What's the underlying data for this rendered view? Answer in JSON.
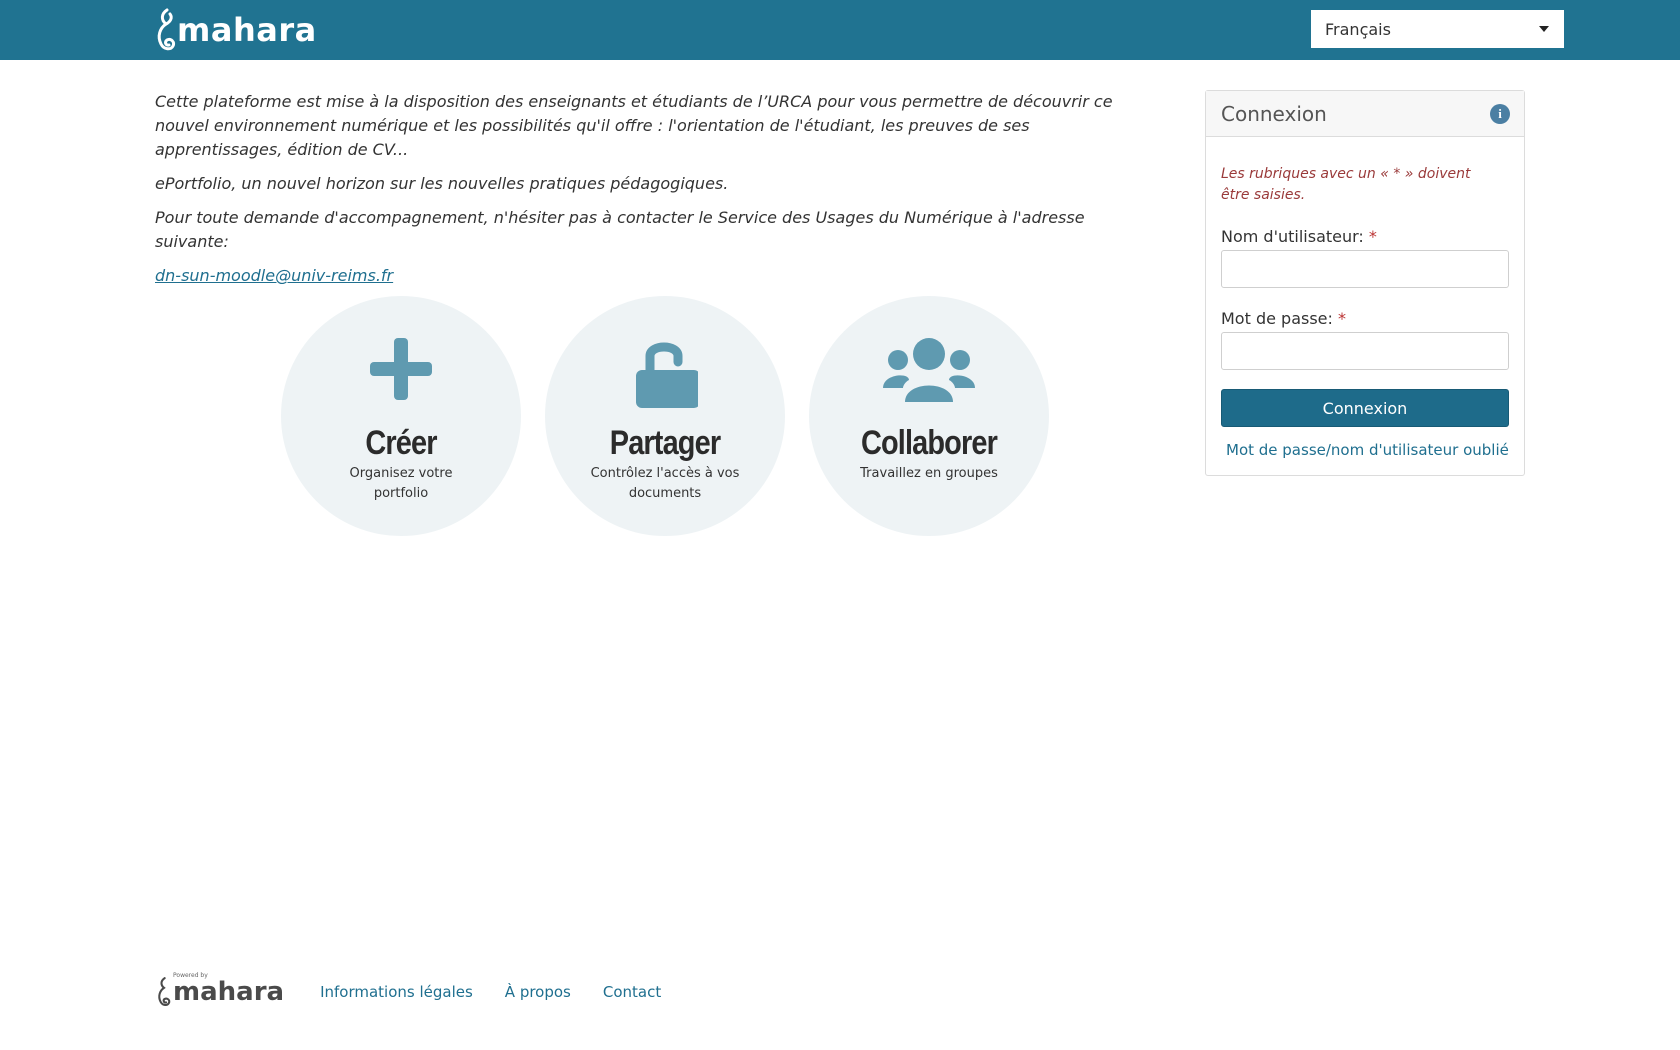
{
  "header": {
    "logo_text": "mahara",
    "language_selected": "Français"
  },
  "intro": {
    "paragraph1": "Cette plateforme est mise à la disposition des enseignants et étudiants de l’URCA pour vous permettre de découvrir ce nouvel environnement numérique et les possibilités qu'il offre : l'orientation de l'étudiant, les preuves de ses apprentissages, édition de CV...",
    "paragraph2": "ePortfolio, un nouvel horizon sur les nouvelles pratiques pédagogiques.",
    "paragraph3": "Pour toute demande d'accompagnement, n'hésiter pas à contacter le Service des Usages du Numérique à l'adresse suivante:",
    "email": "dn-sun-moodle@univ-reims.fr"
  },
  "features": [
    {
      "title": "Créer",
      "subtitle": "Organisez votre portfolio",
      "icon": "plus-icon"
    },
    {
      "title": "Partager",
      "subtitle": "Contrôlez l'accès à vos documents",
      "icon": "unlock-icon"
    },
    {
      "title": "Collaborer",
      "subtitle": "Travaillez en groupes",
      "icon": "users-icon"
    }
  ],
  "login": {
    "title": "Connexion",
    "required_note": "Les rubriques avec un « * » doivent être saisies.",
    "username_label": "Nom d'utilisateur:",
    "password_label": "Mot de passe:",
    "required_mark": "*",
    "submit_label": "Connexion",
    "forgot_link": "Mot de passe/nom d'utilisateur oublié"
  },
  "footer": {
    "powered_by": "Powered by",
    "logo_text": "mahara",
    "links": [
      "Informations légales",
      "À propos",
      "Contact"
    ]
  },
  "colors": {
    "header_bg": "#207391",
    "accent": "#1e6b8a",
    "icon": "#5f9ab0",
    "circle_bg": "#eef3f5"
  }
}
